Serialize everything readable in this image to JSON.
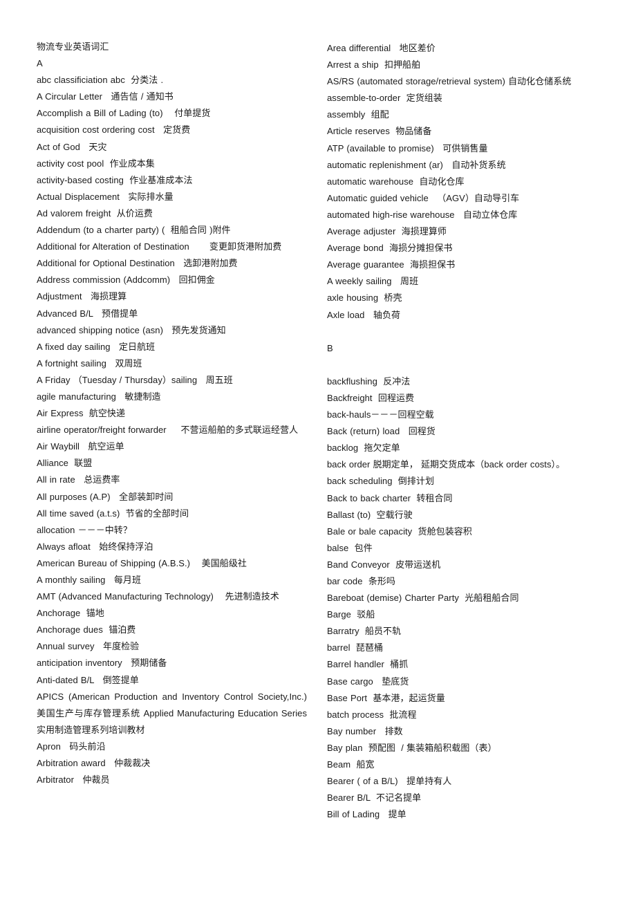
{
  "document": {
    "title": "物流专业英语词汇",
    "text_color": "#1a1a1a",
    "background_color": "#ffffff"
  },
  "left_column": {
    "lines": [
      {
        "kind": "title",
        "text": "物流专业英语词汇"
      },
      {
        "kind": "section",
        "text": "A"
      },
      {
        "kind": "entry",
        "text": "abc classificiation abc  分类法 ."
      },
      {
        "kind": "entry",
        "text": "A Circular Letter   通告信 / 通知书"
      },
      {
        "kind": "entry",
        "text": "Accomplish a Bill of Lading (to)    付单提货"
      },
      {
        "kind": "entry",
        "text": "acquisition cost ordering cost   定货费"
      },
      {
        "kind": "entry",
        "text": "Act of God   天灾"
      },
      {
        "kind": "entry",
        "text": "activity cost pool  作业成本集"
      },
      {
        "kind": "entry",
        "text": "activity-based costing  作业基准成本法"
      },
      {
        "kind": "entry",
        "text": "Actual Displacement   实际排水量"
      },
      {
        "kind": "entry",
        "text": "Ad valorem freight  从价运费"
      },
      {
        "kind": "entry",
        "text": "Addendum (to a charter party) (  租船合同 )附件"
      },
      {
        "kind": "justify",
        "text": "Additional for Alteration of Destination       变更卸货港附加费"
      },
      {
        "kind": "entry",
        "text": "Additional for Optional Destination   选卸港附加费"
      },
      {
        "kind": "entry",
        "text": "Address commission (Addcomm)   回扣佣金"
      },
      {
        "kind": "entry",
        "text": "Adjustment   海损理算"
      },
      {
        "kind": "entry",
        "text": "Advanced B/L   预借提单"
      },
      {
        "kind": "entry",
        "text": "advanced shipping notice (asn)   预先发货通知"
      },
      {
        "kind": "entry",
        "text": "A fixed day sailing   定日航班"
      },
      {
        "kind": "entry",
        "text": "A fortnight sailing   双周班"
      },
      {
        "kind": "entry",
        "text": "A Friday （Tuesday / Thursday）sailing   周五班"
      },
      {
        "kind": "entry",
        "text": "agile manufacturing   敏捷制造"
      },
      {
        "kind": "entry",
        "text": "Air Express  航空快递"
      },
      {
        "kind": "justify",
        "text": "airline operator/freight forwarder     不营运船舶的多式联运经营人"
      },
      {
        "kind": "entry",
        "text": "Air Waybill   航空运单"
      },
      {
        "kind": "entry",
        "text": "Alliance  联盟"
      },
      {
        "kind": "entry",
        "text": "All in rate   总运费率"
      },
      {
        "kind": "entry",
        "text": "All purposes (A.P)   全部装卸时间"
      },
      {
        "kind": "entry",
        "text": "All time saved (a.t.s)  节省的全部时间"
      },
      {
        "kind": "entry",
        "text": "allocation －－－中转？"
      },
      {
        "kind": "entry",
        "text": "Always afloat   始终保持浮泊"
      },
      {
        "kind": "entry",
        "text": "American Bureau of Shipping (A.B.S.)    美国船级社"
      },
      {
        "kind": "entry",
        "text": "A monthly sailing   每月班"
      },
      {
        "kind": "justify",
        "text": "AMT (Advanced Manufacturing Technology)    先进制造技术"
      },
      {
        "kind": "entry",
        "text": "Anchorage  锚地"
      },
      {
        "kind": "entry",
        "text": "Anchorage dues  锚泊费"
      },
      {
        "kind": "entry",
        "text": "Annual survey   年度检验"
      },
      {
        "kind": "entry",
        "text": "anticipation inventory   预期储备"
      },
      {
        "kind": "entry",
        "text": "Anti-dated B/L   倒签提单"
      },
      {
        "kind": "justify",
        "text": "APICS (American Production and Inventory Control Society,Inc.) 美国生产与库存管理系统 Applied Manufacturing Education Series 实用制造管理系列培训教材"
      },
      {
        "kind": "entry",
        "text": "Apron   码头前沿"
      },
      {
        "kind": "entry",
        "text": "Arbitration award   仲裁裁决"
      },
      {
        "kind": "entry",
        "text": "Arbitrator   仲裁员"
      }
    ]
  },
  "right_column": {
    "lines": [
      {
        "kind": "entry",
        "text": "Area differential   地区差价"
      },
      {
        "kind": "entry",
        "text": "Arrest a ship  扣押船舶"
      },
      {
        "kind": "justify",
        "text": "AS/RS (automated storage/retrieval system) 自动化仓储系统"
      },
      {
        "kind": "entry",
        "text": "assemble-to-order  定货组装"
      },
      {
        "kind": "entry",
        "text": "assembly  组配"
      },
      {
        "kind": "entry",
        "text": "Article reserves  物品储备"
      },
      {
        "kind": "entry",
        "text": "ATP (available to promise)   可供销售量"
      },
      {
        "kind": "entry",
        "text": "automatic replenishment (ar)   自动补货系统"
      },
      {
        "kind": "entry",
        "text": "automatic warehouse  自动化仓库"
      },
      {
        "kind": "entry",
        "text": "Automatic guided vehicle   （AGV）自动导引车"
      },
      {
        "kind": "entry",
        "text": "automated high-rise warehouse   自动立体仓库"
      },
      {
        "kind": "entry",
        "text": "Average adjuster  海损理算师"
      },
      {
        "kind": "entry",
        "text": "Average bond  海损分摊担保书"
      },
      {
        "kind": "entry",
        "text": "Average guarantee  海损担保书"
      },
      {
        "kind": "entry",
        "text": "A weekly sailing   周班"
      },
      {
        "kind": "entry",
        "text": "axle housing  桥壳"
      },
      {
        "kind": "entry",
        "text": "Axle load   轴负荷"
      },
      {
        "kind": "blank",
        "text": ""
      },
      {
        "kind": "section",
        "text": "B"
      },
      {
        "kind": "blank",
        "text": ""
      },
      {
        "kind": "entry",
        "text": "backflushing  反冲法"
      },
      {
        "kind": "entry",
        "text": "Backfreight  回程运费"
      },
      {
        "kind": "entry",
        "text": "back-hauls－－－回程空载"
      },
      {
        "kind": "entry",
        "text": "Back (return) load   回程货"
      },
      {
        "kind": "entry",
        "text": "backlog  拖欠定单"
      },
      {
        "kind": "justify",
        "text": "back order 脱期定单， 延期交货成本（back order costs）。"
      },
      {
        "kind": "entry",
        "text": "back scheduling  倒排计划"
      },
      {
        "kind": "entry",
        "text": "Back to back charter  转租合同"
      },
      {
        "kind": "entry",
        "text": "Ballast (to)  空载行驶"
      },
      {
        "kind": "entry",
        "text": "Bale or bale capacity  货舱包装容积"
      },
      {
        "kind": "entry",
        "text": "balse  包件"
      },
      {
        "kind": "entry",
        "text": "Band Conveyor  皮带运送机"
      },
      {
        "kind": "entry",
        "text": "bar code  条形吗"
      },
      {
        "kind": "entry",
        "text": "Bareboat (demise) Charter Party  光船租船合同"
      },
      {
        "kind": "entry",
        "text": "Barge  驳船"
      },
      {
        "kind": "entry",
        "text": "Barratry  船员不轨"
      },
      {
        "kind": "entry",
        "text": "barrel  琵琶桶"
      },
      {
        "kind": "entry",
        "text": "Barrel handler  桶抓"
      },
      {
        "kind": "entry",
        "text": "Base cargo   垫底货"
      },
      {
        "kind": "entry",
        "text": "Base Port  基本港，起运货量"
      },
      {
        "kind": "entry",
        "text": "batch process  批流程"
      },
      {
        "kind": "entry",
        "text": "Bay number   排数"
      },
      {
        "kind": "entry",
        "text": "Bay plan  预配图  / 集装箱船积载图（表）"
      },
      {
        "kind": "entry",
        "text": "Beam  船宽"
      },
      {
        "kind": "entry",
        "text": "Bearer ( of a B/L)   提单持有人"
      },
      {
        "kind": "entry",
        "text": "Bearer B/L  不记名提单"
      },
      {
        "kind": "entry",
        "text": "Bill of Lading   提单"
      }
    ]
  }
}
